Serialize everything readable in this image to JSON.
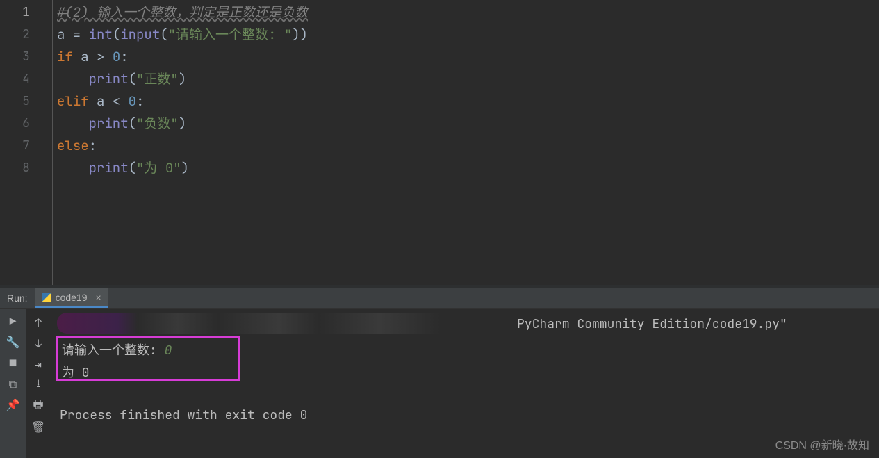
{
  "editor": {
    "lines": [
      "1",
      "2",
      "3",
      "4",
      "5",
      "6",
      "7",
      "8"
    ],
    "code": {
      "l1_comment": "#(2) 输入一个整数，判定是正数还是负数",
      "l2_a": "a",
      "l2_eq": " = ",
      "l2_int": "int",
      "l2_input": "input",
      "l2_str": "\"请输入一个整数: \"",
      "l3_if": "if",
      "l3_a": " a > ",
      "l3_n": "0",
      "l3_c": ":",
      "l4_print": "print",
      "l4_str": "\"正数\"",
      "l5_elif": "elif",
      "l5_a": " a < ",
      "l5_n": "0",
      "l5_c": ":",
      "l6_print": "print",
      "l6_str": "\"负数\"",
      "l7_else": "else",
      "l7_c": ":",
      "l8_print": "print",
      "l8_str": "\"为 0\""
    }
  },
  "run": {
    "label": "Run:",
    "tab": "code19"
  },
  "console": {
    "path": "PyCharm Community Edition/code19.py\"",
    "prompt": "请输入一个整数: ",
    "input": "0",
    "result": "为 0",
    "exit": "Process finished with exit code 0"
  },
  "watermark": "CSDN @新晓·故知"
}
